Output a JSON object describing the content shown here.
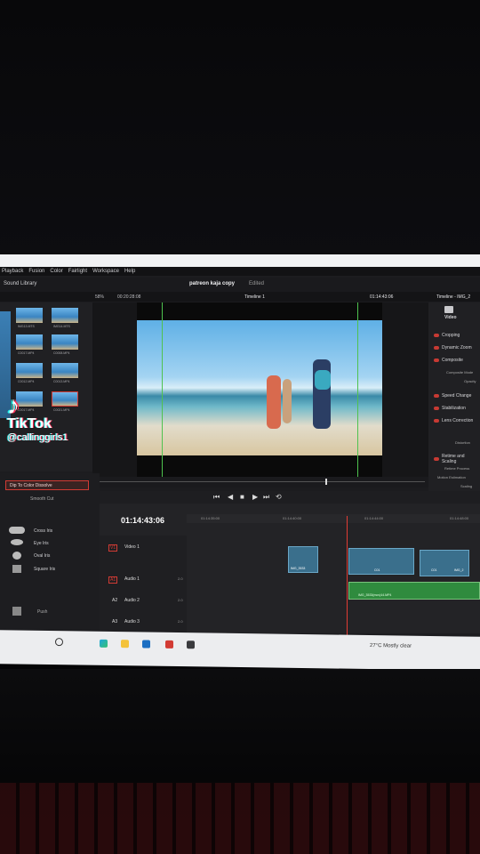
{
  "menu": [
    "Playback",
    "Fusion",
    "Color",
    "Fairlight",
    "Workspace",
    "Help"
  ],
  "header": {
    "sound_library": "Sound Library",
    "project": "patreon kaja copy",
    "status": "Edited",
    "zoom": "58%",
    "source_tc": "00:20:28:08",
    "timeline_name": "Timeline 1",
    "record_tc": "01:14:43:06",
    "inspector_title": "Timeline - IMG_2"
  },
  "media_pool": {
    "items": [
      "IMG13.MTS",
      "IMG14.MTS",
      "C0017.MP4",
      "C0008.MP4",
      "C0012.MP4",
      "C0013.MP4",
      "C0017.MP4",
      "C0021.MP4"
    ]
  },
  "inspector": {
    "tab": "Video",
    "sections": [
      "Cropping",
      "Dynamic Zoom",
      "Composite",
      "Composite Mode",
      "Opacity",
      "Speed Change",
      "Stabilization",
      "Lens Correction",
      "Distortion",
      "Retime and Scaling",
      "Retime Process",
      "Motion Estimation",
      "Scaling",
      "Resize Filter"
    ]
  },
  "effects": {
    "selected": "Dip To Color Dissolve",
    "items": [
      "Smooth Cut",
      "Cross Iris",
      "Eye Iris",
      "Oval Iris",
      "Square Iris",
      "Push"
    ]
  },
  "timeline": {
    "timecode": "01:14:43:06",
    "ruler": [
      "01:14:35:00",
      "01:14:40:00",
      "01:14:44:00",
      "01:14:48:00"
    ],
    "tracks": [
      {
        "id": "V1",
        "name": "Video 1"
      },
      {
        "id": "A1",
        "name": "Audio 1",
        "level": "2.0"
      },
      {
        "id": "A2",
        "name": "Audio 2",
        "level": "2.0"
      },
      {
        "id": "A3",
        "name": "Audio 3",
        "level": "2.0"
      }
    ],
    "clip_left": "IMG_3533",
    "clips_right": [
      "C01",
      "C01",
      "IMG_2"
    ],
    "audio_clip": "IMG_3533(mov)44.MP4"
  },
  "taskbar": {
    "weather": "27°C  Mostly clear"
  },
  "overlay": {
    "brand": "TikTok",
    "user": "@callinggirls1"
  },
  "colors": {
    "accent_red": "#d23b34",
    "audio_green": "#2f8b3e",
    "video_blue": "#3a6f8c"
  }
}
